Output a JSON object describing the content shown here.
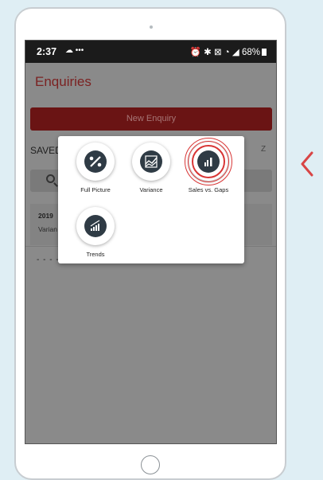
{
  "status_bar": {
    "time": "2:37",
    "left_icons": "☁ •••",
    "right_icons": "⏰ ✱ ⊠ ◔ ◢",
    "battery": "68%"
  },
  "app": {
    "title": "Enquiries",
    "new_enquiry_label": "New Enquiry",
    "saved_label": "SAVED",
    "partial_right_text": "Z"
  },
  "enquiries": [
    {
      "year": "2019",
      "subtitle": "Varian"
    }
  ],
  "dashes": "- - - -",
  "popup": {
    "tiles": [
      {
        "label": "Full Picture",
        "icon": "full-picture-icon"
      },
      {
        "label": "Variance",
        "icon": "variance-icon"
      },
      {
        "label": "Sales vs. Gaps",
        "icon": "sales-gaps-icon",
        "highlighted": true
      },
      {
        "label": "Trends",
        "icon": "trends-icon"
      }
    ]
  },
  "colors": {
    "accent_red": "#d83535",
    "icon_dark": "#2f3b45",
    "title_red": "#7b2222"
  }
}
